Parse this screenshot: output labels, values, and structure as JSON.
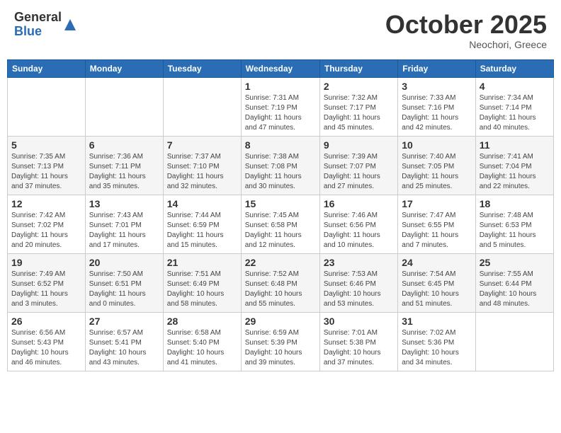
{
  "header": {
    "logo_general": "General",
    "logo_blue": "Blue",
    "month_title": "October 2025",
    "location": "Neochori, Greece"
  },
  "calendar": {
    "weekdays": [
      "Sunday",
      "Monday",
      "Tuesday",
      "Wednesday",
      "Thursday",
      "Friday",
      "Saturday"
    ],
    "weeks": [
      [
        {
          "day": "",
          "info": ""
        },
        {
          "day": "",
          "info": ""
        },
        {
          "day": "",
          "info": ""
        },
        {
          "day": "1",
          "info": "Sunrise: 7:31 AM\nSunset: 7:19 PM\nDaylight: 11 hours\nand 47 minutes."
        },
        {
          "day": "2",
          "info": "Sunrise: 7:32 AM\nSunset: 7:17 PM\nDaylight: 11 hours\nand 45 minutes."
        },
        {
          "day": "3",
          "info": "Sunrise: 7:33 AM\nSunset: 7:16 PM\nDaylight: 11 hours\nand 42 minutes."
        },
        {
          "day": "4",
          "info": "Sunrise: 7:34 AM\nSunset: 7:14 PM\nDaylight: 11 hours\nand 40 minutes."
        }
      ],
      [
        {
          "day": "5",
          "info": "Sunrise: 7:35 AM\nSunset: 7:13 PM\nDaylight: 11 hours\nand 37 minutes."
        },
        {
          "day": "6",
          "info": "Sunrise: 7:36 AM\nSunset: 7:11 PM\nDaylight: 11 hours\nand 35 minutes."
        },
        {
          "day": "7",
          "info": "Sunrise: 7:37 AM\nSunset: 7:10 PM\nDaylight: 11 hours\nand 32 minutes."
        },
        {
          "day": "8",
          "info": "Sunrise: 7:38 AM\nSunset: 7:08 PM\nDaylight: 11 hours\nand 30 minutes."
        },
        {
          "day": "9",
          "info": "Sunrise: 7:39 AM\nSunset: 7:07 PM\nDaylight: 11 hours\nand 27 minutes."
        },
        {
          "day": "10",
          "info": "Sunrise: 7:40 AM\nSunset: 7:05 PM\nDaylight: 11 hours\nand 25 minutes."
        },
        {
          "day": "11",
          "info": "Sunrise: 7:41 AM\nSunset: 7:04 PM\nDaylight: 11 hours\nand 22 minutes."
        }
      ],
      [
        {
          "day": "12",
          "info": "Sunrise: 7:42 AM\nSunset: 7:02 PM\nDaylight: 11 hours\nand 20 minutes."
        },
        {
          "day": "13",
          "info": "Sunrise: 7:43 AM\nSunset: 7:01 PM\nDaylight: 11 hours\nand 17 minutes."
        },
        {
          "day": "14",
          "info": "Sunrise: 7:44 AM\nSunset: 6:59 PM\nDaylight: 11 hours\nand 15 minutes."
        },
        {
          "day": "15",
          "info": "Sunrise: 7:45 AM\nSunset: 6:58 PM\nDaylight: 11 hours\nand 12 minutes."
        },
        {
          "day": "16",
          "info": "Sunrise: 7:46 AM\nSunset: 6:56 PM\nDaylight: 11 hours\nand 10 minutes."
        },
        {
          "day": "17",
          "info": "Sunrise: 7:47 AM\nSunset: 6:55 PM\nDaylight: 11 hours\nand 7 minutes."
        },
        {
          "day": "18",
          "info": "Sunrise: 7:48 AM\nSunset: 6:53 PM\nDaylight: 11 hours\nand 5 minutes."
        }
      ],
      [
        {
          "day": "19",
          "info": "Sunrise: 7:49 AM\nSunset: 6:52 PM\nDaylight: 11 hours\nand 3 minutes."
        },
        {
          "day": "20",
          "info": "Sunrise: 7:50 AM\nSunset: 6:51 PM\nDaylight: 11 hours\nand 0 minutes."
        },
        {
          "day": "21",
          "info": "Sunrise: 7:51 AM\nSunset: 6:49 PM\nDaylight: 10 hours\nand 58 minutes."
        },
        {
          "day": "22",
          "info": "Sunrise: 7:52 AM\nSunset: 6:48 PM\nDaylight: 10 hours\nand 55 minutes."
        },
        {
          "day": "23",
          "info": "Sunrise: 7:53 AM\nSunset: 6:46 PM\nDaylight: 10 hours\nand 53 minutes."
        },
        {
          "day": "24",
          "info": "Sunrise: 7:54 AM\nSunset: 6:45 PM\nDaylight: 10 hours\nand 51 minutes."
        },
        {
          "day": "25",
          "info": "Sunrise: 7:55 AM\nSunset: 6:44 PM\nDaylight: 10 hours\nand 48 minutes."
        }
      ],
      [
        {
          "day": "26",
          "info": "Sunrise: 6:56 AM\nSunset: 5:43 PM\nDaylight: 10 hours\nand 46 minutes."
        },
        {
          "day": "27",
          "info": "Sunrise: 6:57 AM\nSunset: 5:41 PM\nDaylight: 10 hours\nand 43 minutes."
        },
        {
          "day": "28",
          "info": "Sunrise: 6:58 AM\nSunset: 5:40 PM\nDaylight: 10 hours\nand 41 minutes."
        },
        {
          "day": "29",
          "info": "Sunrise: 6:59 AM\nSunset: 5:39 PM\nDaylight: 10 hours\nand 39 minutes."
        },
        {
          "day": "30",
          "info": "Sunrise: 7:01 AM\nSunset: 5:38 PM\nDaylight: 10 hours\nand 37 minutes."
        },
        {
          "day": "31",
          "info": "Sunrise: 7:02 AM\nSunset: 5:36 PM\nDaylight: 10 hours\nand 34 minutes."
        },
        {
          "day": "",
          "info": ""
        }
      ]
    ]
  }
}
